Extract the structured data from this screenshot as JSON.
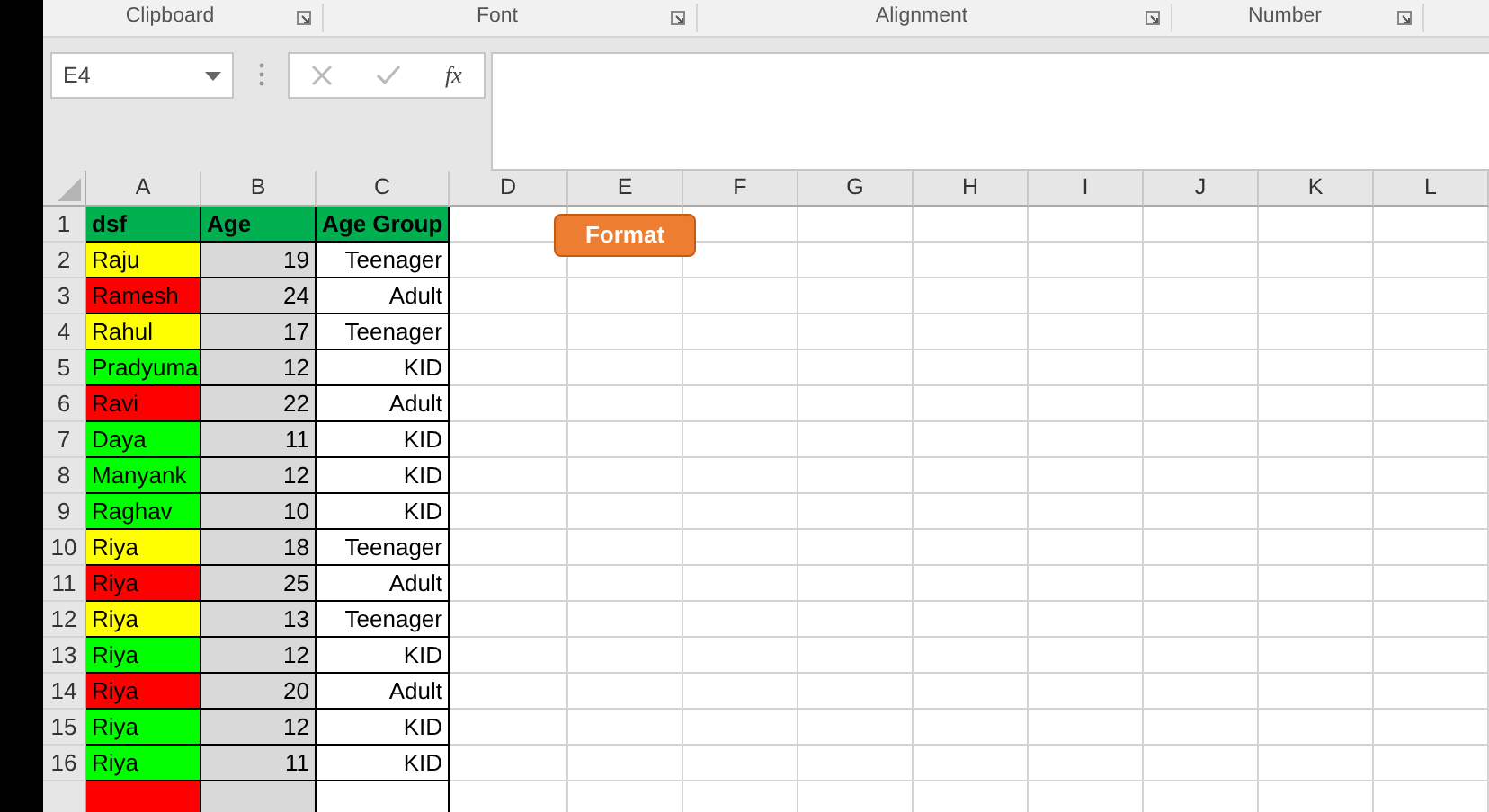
{
  "ribbon_groups": [
    {
      "label": "Clipboard"
    },
    {
      "label": "Font"
    },
    {
      "label": "Alignment"
    },
    {
      "label": "Number"
    }
  ],
  "formula_bar": {
    "name_box": "E4",
    "function_button": "fx"
  },
  "columns": [
    "A",
    "B",
    "C",
    "D",
    "E",
    "F",
    "G",
    "H",
    "I",
    "J",
    "K",
    "L"
  ],
  "rows": [
    {
      "kind": "header",
      "number": "1",
      "name": "dsf",
      "age": "Age",
      "group": "Age Group",
      "color": "#00b050"
    },
    {
      "kind": "data",
      "number": "2",
      "name": "Raju",
      "age": "19",
      "group": "Teenager",
      "color": "#ffff00"
    },
    {
      "kind": "data",
      "number": "3",
      "name": "Ramesh",
      "age": "24",
      "group": "Adult",
      "color": "#ff0000"
    },
    {
      "kind": "data",
      "number": "4",
      "name": "Rahul",
      "age": "17",
      "group": "Teenager",
      "color": "#ffff00"
    },
    {
      "kind": "data",
      "number": "5",
      "name": "Pradyuma",
      "age": "12",
      "group": "KID",
      "color": "#00ff00"
    },
    {
      "kind": "data",
      "number": "6",
      "name": "Ravi",
      "age": "22",
      "group": "Adult",
      "color": "#ff0000"
    },
    {
      "kind": "data",
      "number": "7",
      "name": "Daya",
      "age": "11",
      "group": "KID",
      "color": "#00ff00"
    },
    {
      "kind": "data",
      "number": "8",
      "name": "Manyank",
      "age": "12",
      "group": "KID",
      "color": "#00ff00"
    },
    {
      "kind": "data",
      "number": "9",
      "name": "Raghav",
      "age": "10",
      "group": "KID",
      "color": "#00ff00"
    },
    {
      "kind": "data",
      "number": "10",
      "name": "Riya",
      "age": "18",
      "group": "Teenager",
      "color": "#ffff00"
    },
    {
      "kind": "data",
      "number": "11",
      "name": "Riya",
      "age": "25",
      "group": "Adult",
      "color": "#ff0000"
    },
    {
      "kind": "data",
      "number": "12",
      "name": "Riya",
      "age": "13",
      "group": "Teenager",
      "color": "#ffff00"
    },
    {
      "kind": "data",
      "number": "13",
      "name": "Riya",
      "age": "12",
      "group": "KID",
      "color": "#00ff00"
    },
    {
      "kind": "data",
      "number": "14",
      "name": "Riya",
      "age": "20",
      "group": "Adult",
      "color": "#ff0000"
    },
    {
      "kind": "data",
      "number": "15",
      "name": "Riya",
      "age": "12",
      "group": "KID",
      "color": "#00ff00"
    },
    {
      "kind": "data",
      "number": "16",
      "name": "Riya",
      "age": "11",
      "group": "KID",
      "color": "#00ff00"
    },
    {
      "kind": "data",
      "color": "#ff0000"
    }
  ],
  "format_button": {
    "label": "Format"
  }
}
